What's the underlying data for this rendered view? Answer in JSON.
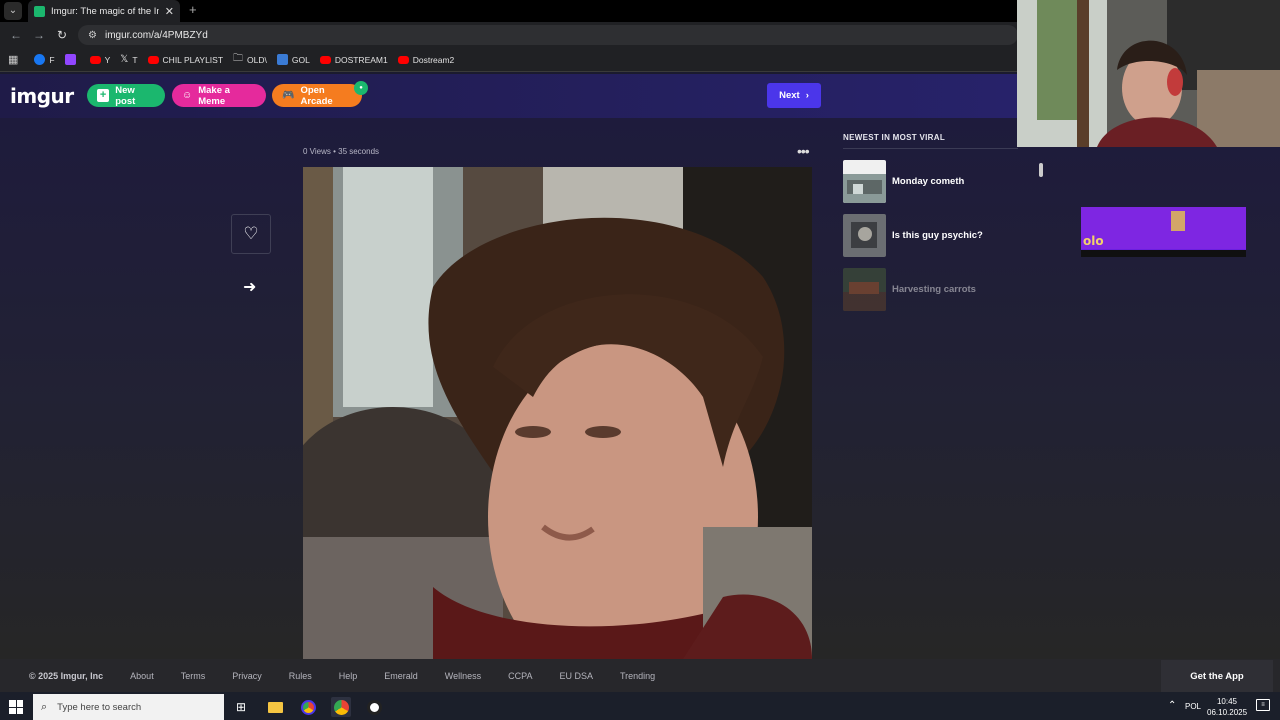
{
  "browser": {
    "tab_title": "Imgur: The magic of the Interne",
    "url": "imgur.com/a/4PMBZYd",
    "bookmarks": [
      {
        "label": "F",
        "color": "#1877f2"
      },
      {
        "label": "",
        "color": "#9146ff"
      },
      {
        "label": "Y",
        "color": "#ff0000"
      },
      {
        "label": "T",
        "color": "#000000"
      },
      {
        "label": "CHIL PLAYLIST",
        "color": "#ff0000"
      },
      {
        "label": "OLD\\",
        "color": "folder"
      },
      {
        "label": "GOL",
        "color": "#3a7bd5"
      },
      {
        "label": "DOSTREAM1",
        "color": "#ff0000"
      },
      {
        "label": "Dostream2",
        "color": "#ff0000"
      }
    ]
  },
  "header": {
    "logo": "imgur",
    "new_post": "New post",
    "make_meme": "Make a Meme",
    "open_arcade": "Open Arcade",
    "next": "Next"
  },
  "post": {
    "meta": "0 Views • 35 seconds"
  },
  "sidebar": {
    "title": "NEWEST IN MOST VIRAL",
    "items": [
      {
        "label": "Monday cometh"
      },
      {
        "label": "Is this guy psychic?"
      },
      {
        "label": "Harvesting carrots"
      }
    ]
  },
  "footer": {
    "copyright": "© 2025 Imgur, Inc",
    "links": [
      "About",
      "Terms",
      "Privacy",
      "Rules",
      "Help",
      "Emerald",
      "Wellness",
      "CCPA",
      "EU DSA",
      "Trending"
    ],
    "get_app": "Get the App"
  },
  "taskbar": {
    "search_placeholder": "Type here to search",
    "lang": "POL",
    "time": "10:45",
    "date": "06.10.2025"
  },
  "colors": {
    "imgur_green": "#1bb76e",
    "meme_pink": "#e52a9c",
    "arcade_orange": "#f57c1f",
    "next_blue": "#4b36ea"
  }
}
